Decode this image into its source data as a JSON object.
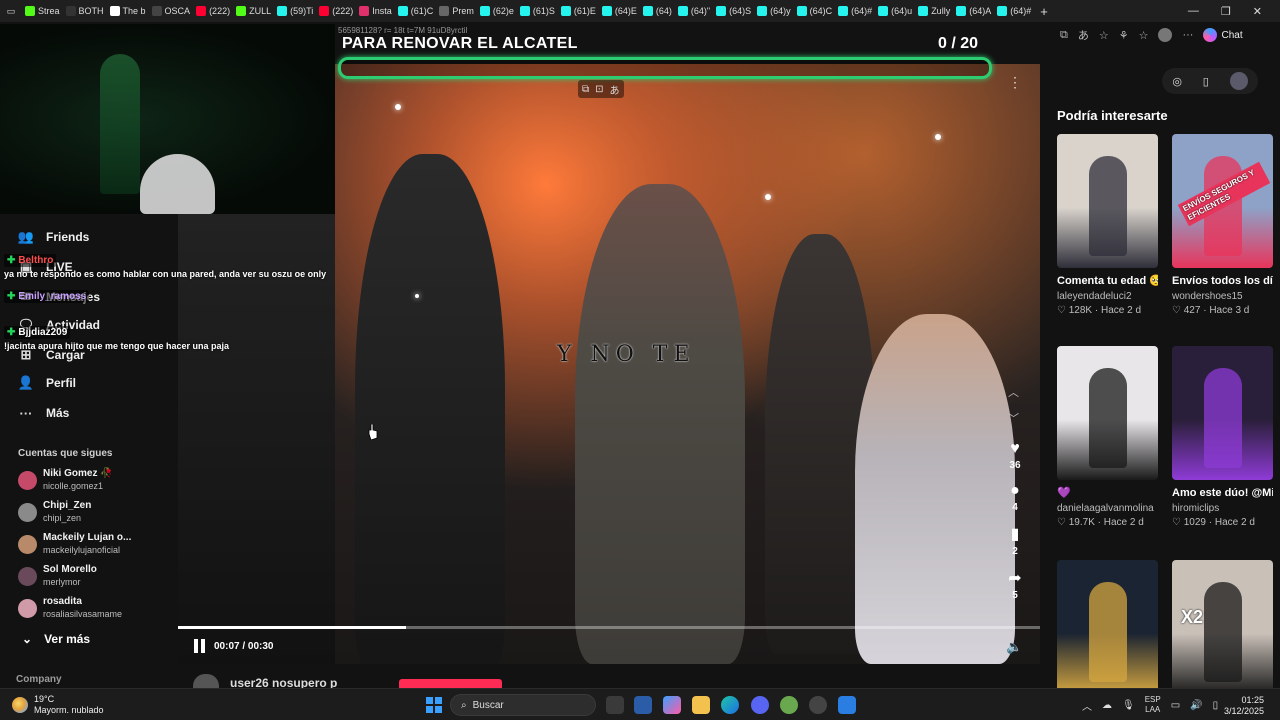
{
  "browser": {
    "tabs": [
      {
        "label": "Strea",
        "color": "#53fc18"
      },
      {
        "label": "BOTH",
        "color": "#333333"
      },
      {
        "label": "The b",
        "color": "#ffffff"
      },
      {
        "label": "OSCA",
        "color": "#444444"
      },
      {
        "label": "(222)",
        "color": "#ff0033"
      },
      {
        "label": "ZULL",
        "color": "#53fc18"
      },
      {
        "label": "(59)Ti",
        "color": "#25f4ee"
      },
      {
        "label": "(222)",
        "color": "#ff0033"
      },
      {
        "label": "Insta",
        "color": "#e1306c"
      },
      {
        "label": "(61)C",
        "color": "#25f4ee"
      },
      {
        "label": "Prem",
        "color": "#666666"
      },
      {
        "label": "(62)e",
        "color": "#25f4ee"
      },
      {
        "label": "(61)S",
        "color": "#25f4ee"
      },
      {
        "label": "(61)E",
        "color": "#25f4ee"
      },
      {
        "label": "(64)E",
        "color": "#25f4ee"
      },
      {
        "label": "(64)",
        "color": "#25f4ee"
      },
      {
        "label": "(64)\"",
        "color": "#25f4ee"
      },
      {
        "label": "(64)S",
        "color": "#25f4ee"
      },
      {
        "label": "(64)y",
        "color": "#25f4ee"
      },
      {
        "label": "(64)C",
        "color": "#25f4ee"
      },
      {
        "label": "(64)#",
        "color": "#25f4ee"
      },
      {
        "label": "(64)u",
        "color": "#25f4ee"
      },
      {
        "label": "Zully",
        "color": "#25f4ee"
      },
      {
        "label": "(64)A",
        "color": "#25f4ee"
      },
      {
        "label": "(64)#",
        "color": "#25f4ee"
      }
    ],
    "new_tab": "+",
    "chat_label": "Chat",
    "top_faint": "565981128? r= 18t t=7M 91uD8yrctil"
  },
  "overlay": {
    "goal_title": "PARA RENOVAR EL ALCATEL",
    "goal_count": "0  / 20",
    "goal_progress": 0
  },
  "chat": [
    {
      "name": "Belthro",
      "color": "#ff4d4d",
      "message": "ya no te respondo es como hablar con una pared, anda ver su oszu oe only"
    },
    {
      "name": "Emily_ramoss",
      "color": "#c7a0ff",
      "message": ""
    },
    {
      "name": "Bjjdiaz209",
      "color": "#ffffff",
      "message": "!jacinta apura hijto que me tengo que hacer una paja"
    }
  ],
  "sidebar": {
    "nav": [
      {
        "label": "Friends",
        "icon": "friends-icon",
        "glyph": "👥"
      },
      {
        "label": "LIVE",
        "icon": "live-icon",
        "glyph": "▣"
      },
      {
        "label": "Mensajes",
        "icon": "messages-icon",
        "glyph": "✉"
      },
      {
        "label": "Actividad",
        "icon": "activity-icon",
        "glyph": "🗨"
      },
      {
        "label": "Cargar",
        "icon": "upload-icon",
        "glyph": "⊞"
      },
      {
        "label": "Perfil",
        "icon": "profile-icon",
        "glyph": "👤"
      },
      {
        "label": "Más",
        "icon": "more-icon",
        "glyph": "···"
      }
    ],
    "following_title": "Cuentas que sigues",
    "following": [
      {
        "name": "Niki Gomez 🥀",
        "handle": "nicolle.gomez1",
        "color": "#c54a6a"
      },
      {
        "name": "Chipi_Zen",
        "handle": "chipi_zen",
        "color": "#8a8a8a"
      },
      {
        "name": "Mackeily Lujan o...",
        "handle": "mackeilylujanoficial",
        "color": "#b88a6a"
      },
      {
        "name": "Sol Morello",
        "handle": "merlymor",
        "color": "#6a4a5a"
      },
      {
        "name": "rosadita",
        "handle": "rosaliasilvasamame",
        "color": "#d19aa8"
      }
    ],
    "ver_mas": "Ver más",
    "company": "Company"
  },
  "video": {
    "lyric_text": "Y NO TE",
    "time": "00:07 / 00:30",
    "progress": 0.265,
    "below_user": "user26 nosupero p",
    "actions": [
      {
        "icon": "heart-icon",
        "glyph": "♥",
        "count": "36"
      },
      {
        "icon": "comment-icon",
        "glyph": "●",
        "count": "4"
      },
      {
        "icon": "bookmark-icon",
        "glyph": "▮",
        "count": "2"
      },
      {
        "icon": "share-icon",
        "glyph": "➦",
        "count": "5"
      }
    ]
  },
  "recommendations": {
    "title": "Podría interesarte",
    "cards": [
      {
        "caption": "Comenta tu edad 🥺 💘 #viral",
        "author": "laleyendadeluci2",
        "meta": "♡ 128K · Hace 2 d",
        "bg": "#d9d3cc",
        "accent": "#2f2f3a",
        "label": ""
      },
      {
        "caption": "Envíos todos los días 🔥contamos con u...",
        "author": "wondershoes15",
        "meta": "♡ 427 · Hace 3 d",
        "bg": "#8ea2c8",
        "accent": "#e8345b",
        "label": "ENVÍOS SEGUROS Y EFICIENTES"
      },
      {
        "caption": "💜",
        "author": "danielaagalvanmolina",
        "meta": "♡ 19.7K · Hace 2 d",
        "bg": "#e9e6ea",
        "accent": "#1a1a1a",
        "label": ""
      },
      {
        "caption": "Amo este dúo! @Milenka_nolasco...",
        "author": "hiromiclips",
        "meta": "♡ 1029 · Hace 2 d",
        "bg": "#2a1f3a",
        "accent": "#8e3bd6",
        "label": ""
      },
      {
        "caption": "",
        "author": "",
        "meta": "",
        "bg": "#1b2432",
        "accent": "#d4a640",
        "label": ""
      },
      {
        "caption": "",
        "author": "",
        "meta": "",
        "bg": "#c9c0b8",
        "accent": "#1a1a1a",
        "label": "X2"
      }
    ]
  },
  "taskbar": {
    "temp": "19°C",
    "weather": "Mayorm. nublado",
    "search": "Buscar",
    "lang_top": "ESP",
    "lang_bottom": "LAA",
    "time": "01:25",
    "date": "3/12/2025"
  }
}
